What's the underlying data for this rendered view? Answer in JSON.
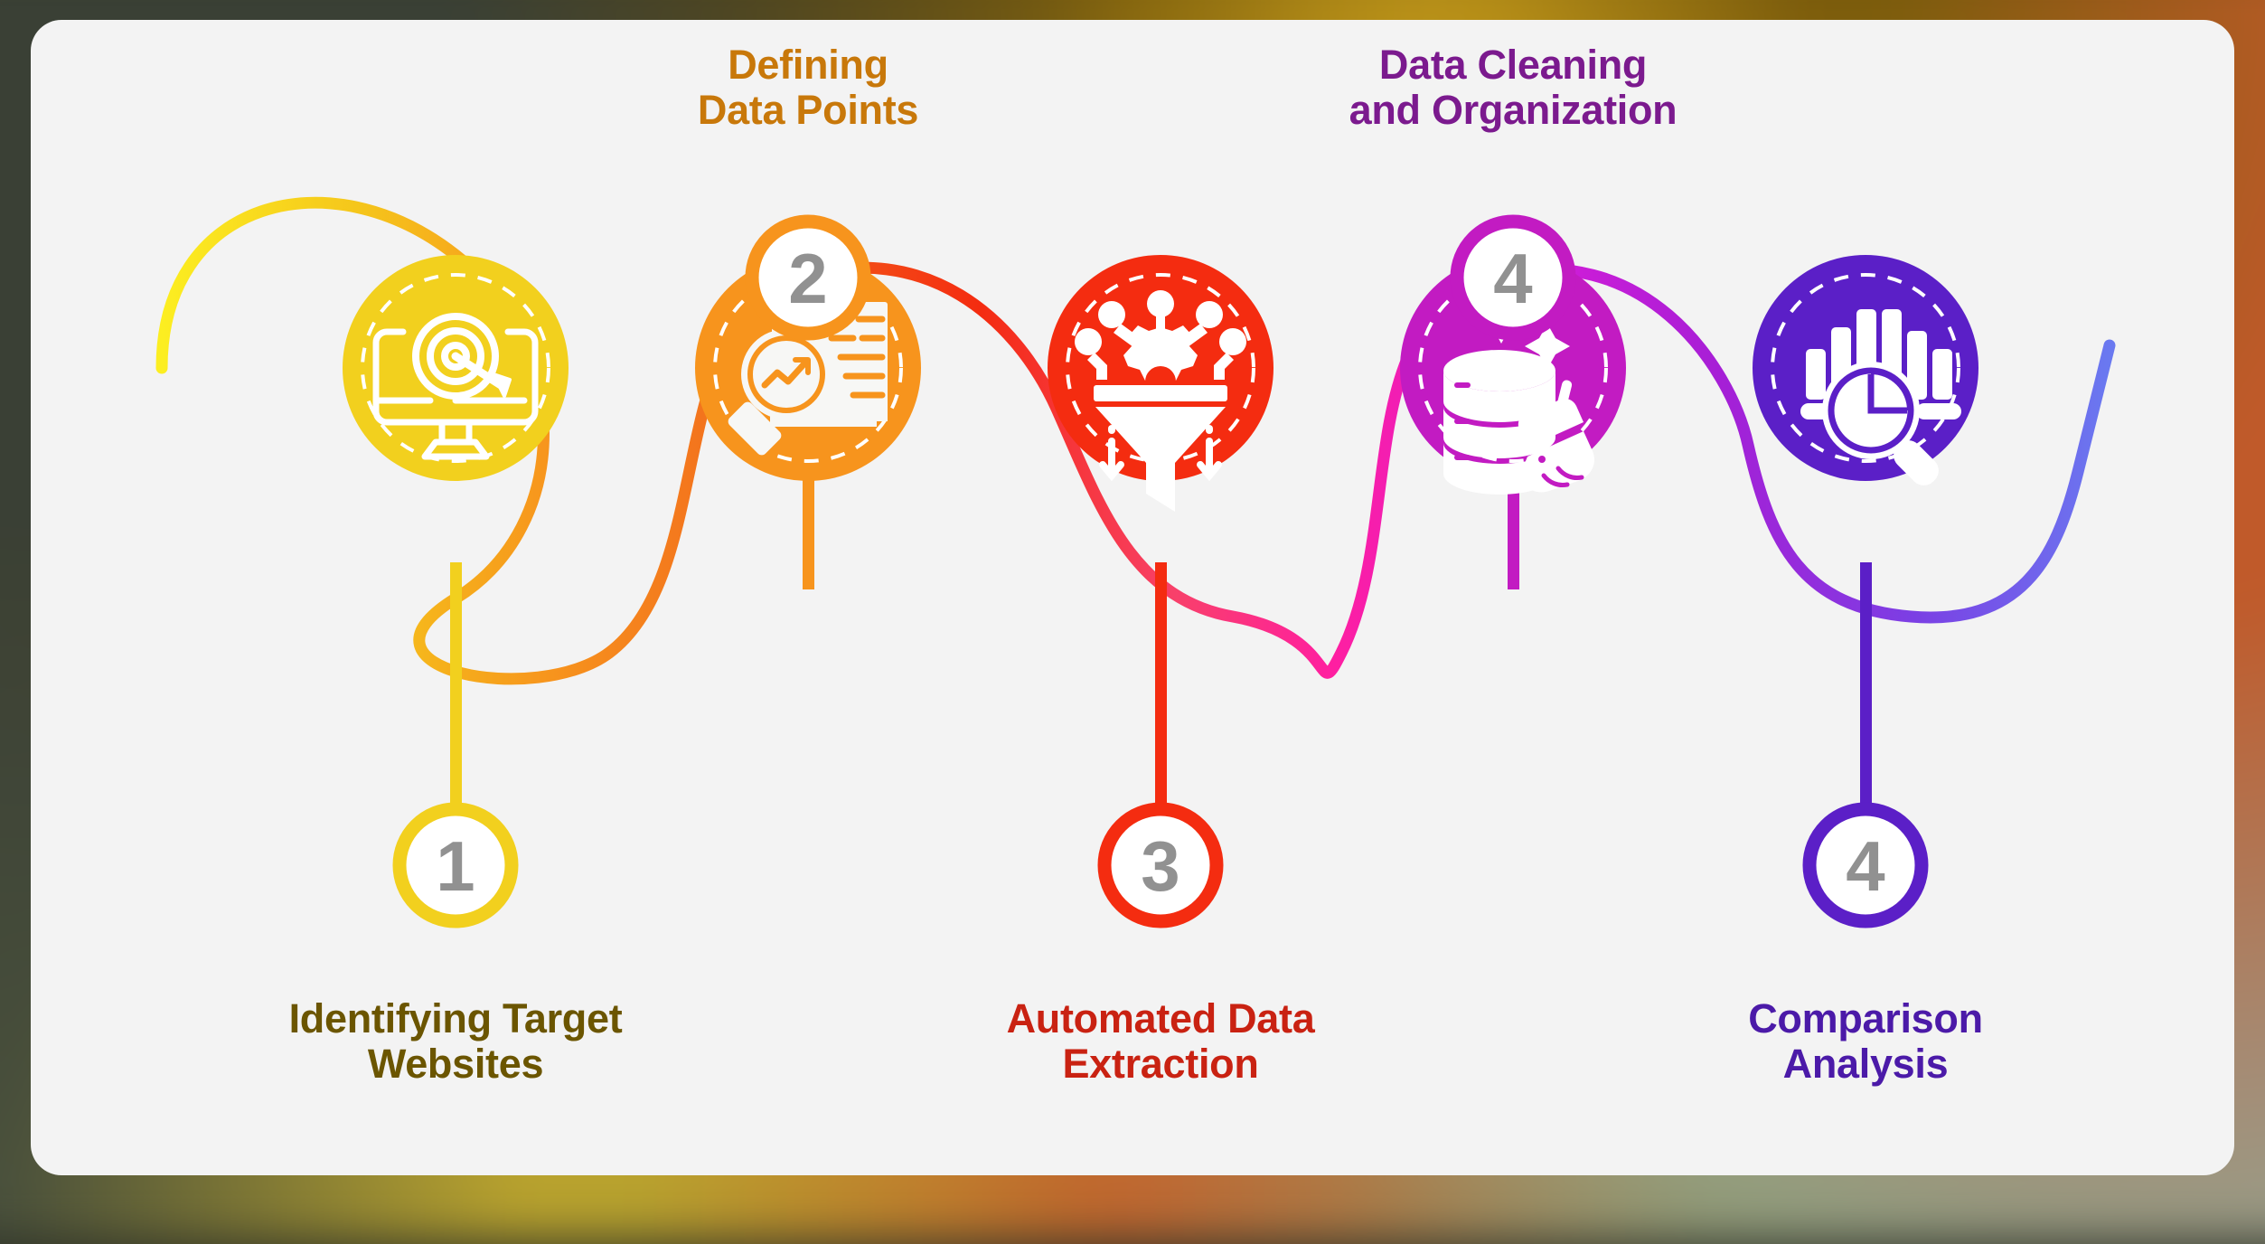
{
  "card": {
    "background": "#f3f3f3",
    "corner_radius": 34
  },
  "diagram": {
    "type": "process-flow",
    "orientation": "horizontal-serpentine",
    "step_count": 5,
    "number_text_color": "#919191",
    "number_circle_fill": "#ffffff",
    "steps": [
      {
        "number": "1",
        "label": "Identifying Target\nWebsites",
        "label_position": "bottom",
        "badge_position": "bottom",
        "color": "#F2D01E",
        "label_color": "#6B5500",
        "icon": "monitor-target-arrow-icon"
      },
      {
        "number": "2",
        "label": "Defining\nData Points",
        "label_position": "top",
        "badge_position": "top",
        "color": "#F7941D",
        "label_color": "#C8780A",
        "icon": "document-magnifier-trend-icon"
      },
      {
        "number": "3",
        "label": "Automated Data\nExtraction",
        "label_position": "bottom",
        "badge_position": "bottom",
        "color": "#F42C10",
        "label_color": "#C92212",
        "icon": "data-funnel-gear-icon"
      },
      {
        "number": "4",
        "label": "Data Cleaning\nand Organization",
        "label_position": "top",
        "badge_position": "top",
        "color": "#C21BC2",
        "label_color": "#7B1A8E",
        "icon": "database-broom-clean-icon"
      },
      {
        "number": "4",
        "label": "Comparison\nAnalysis",
        "label_position": "bottom",
        "badge_position": "bottom",
        "color": "#5B1FC7",
        "label_color": "#4B1AA8",
        "icon": "bar-chart-pie-magnifier-icon"
      }
    ],
    "ribbon": {
      "gradient_stops": [
        "#FCEE21",
        "#F5C61B",
        "#F7941D",
        "#F26B1D",
        "#F42C10",
        "#F8406A",
        "#FF1FA0",
        "#D81CD8",
        "#A61FD6",
        "#7B3FE4",
        "#6A79F0"
      ],
      "stroke_width": 13
    }
  }
}
